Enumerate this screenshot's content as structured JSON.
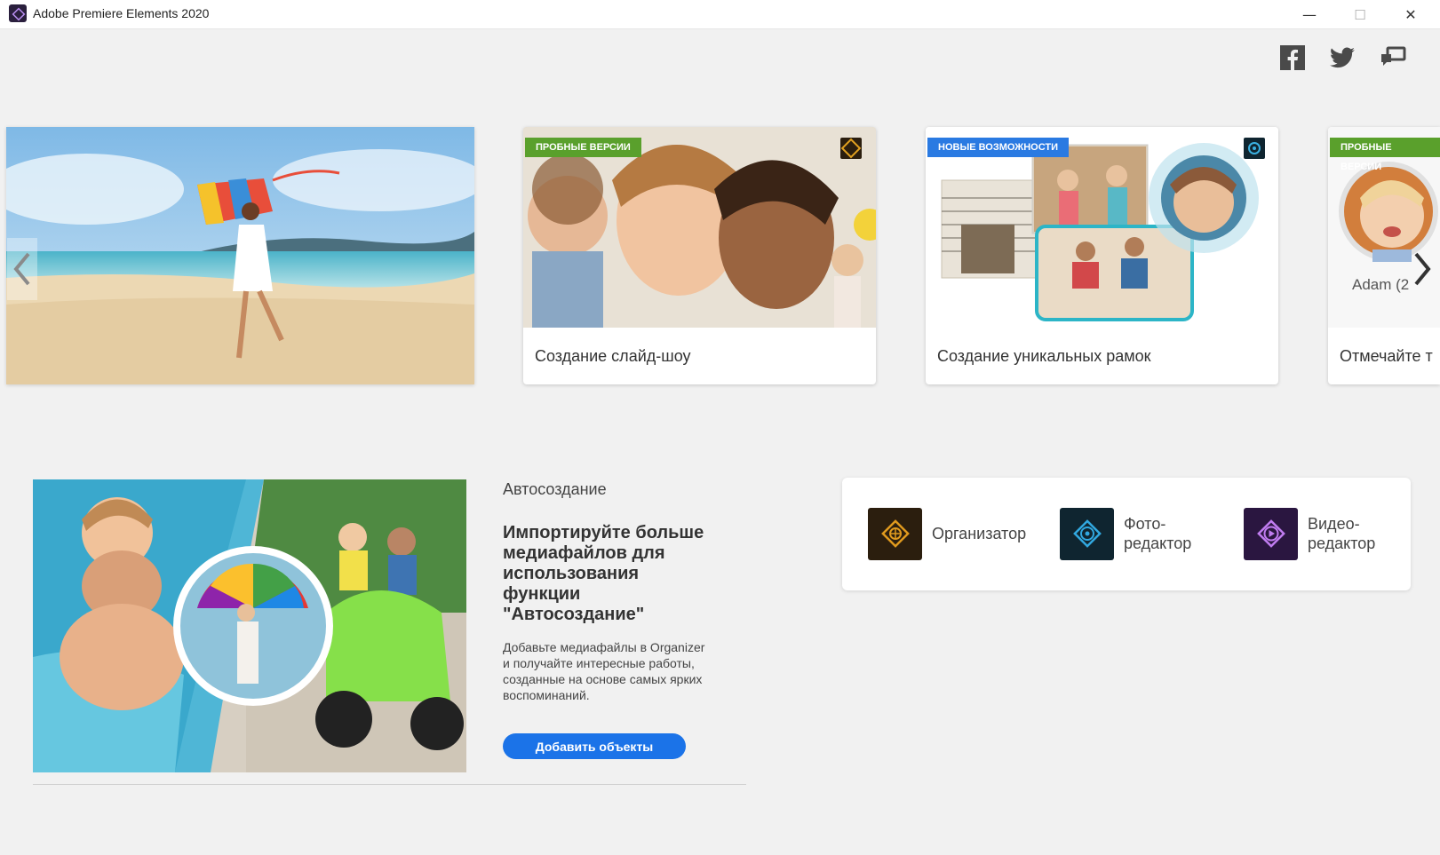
{
  "window": {
    "title": "Adobe Premiere Elements 2020",
    "minimize_glyph": "—",
    "maximize_glyph": "☐",
    "close_glyph": "✕"
  },
  "social": [
    {
      "icon": "facebook-icon"
    },
    {
      "icon": "twitter-icon"
    },
    {
      "icon": "feedback-icon"
    }
  ],
  "carousel": {
    "cards": [
      {
        "badge": "ПРОБНЫЕ ВЕРСИИ",
        "badge_color": "#5aa02c",
        "caption": "Создание слайд-шоу",
        "app_icon": "organizer-icon"
      },
      {
        "badge": "НОВЫЕ ВОЗМОЖНОСТИ",
        "badge_color": "#2a7ae2",
        "caption": "Создание уникальных рамок",
        "app_icon": "photo-editor-icon"
      },
      {
        "badge": "ПРОБНЫЕ ВЕРСИИ",
        "badge_color": "#5aa02c",
        "caption": "Отмечайте т",
        "thumb_text": "Adam (2"
      }
    ]
  },
  "auto_create": {
    "label": "Автосоздание",
    "heading": "Импортируйте больше медиафайлов для использования функции \"Автосоздание\"",
    "description": "Добавьте медиафайлы в Organizer и получайте интересные работы, созданные на основе самых ярких воспоминаний.",
    "button": "Добавить объекты"
  },
  "launcher": [
    {
      "label": "Организатор",
      "icon": "organizer-icon",
      "color": "#2b1e0e"
    },
    {
      "label": "Фото-\nредактор",
      "icon": "photo-editor-icon",
      "color": "#0f2530"
    },
    {
      "label": "Видео-\nредактор",
      "icon": "video-editor-icon",
      "color": "#2a1640"
    }
  ],
  "colors": {
    "accent": "#1b73e8",
    "badge_green": "#5aa02c",
    "badge_blue": "#2a7ae2"
  }
}
